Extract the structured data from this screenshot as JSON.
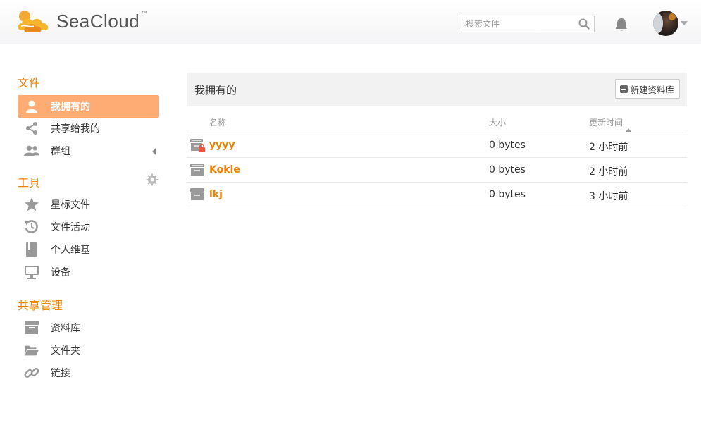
{
  "header": {
    "logo_text": "SeaCloud",
    "logo_tm": "™",
    "search_placeholder": "搜索文件"
  },
  "sidebar": {
    "files_title": "文件",
    "files_items": [
      {
        "label": "我拥有的",
        "icon": "user-icon",
        "active": true
      },
      {
        "label": "共享给我的",
        "icon": "share-icon"
      },
      {
        "label": "群组",
        "icon": "group-icon"
      }
    ],
    "tools_title": "工具",
    "tools_items": [
      {
        "label": "星标文件",
        "icon": "star-icon"
      },
      {
        "label": "文件活动",
        "icon": "history-icon"
      },
      {
        "label": "个人维基",
        "icon": "book-icon"
      },
      {
        "label": "设备",
        "icon": "monitor-icon"
      }
    ],
    "share_title": "共享管理",
    "share_items": [
      {
        "label": "资料库",
        "icon": "archive-icon"
      },
      {
        "label": "文件夹",
        "icon": "folder-open-icon"
      },
      {
        "label": "链接",
        "icon": "link-icon"
      }
    ]
  },
  "main": {
    "title": "我拥有的",
    "new_library_label": "新建资料库",
    "columns": {
      "name": "名称",
      "size": "大小",
      "updated": "更新时间"
    },
    "rows": [
      {
        "name": "yyyy",
        "size": "0 bytes",
        "updated": "2 小时前",
        "encrypted": true
      },
      {
        "name": "Kokle",
        "size": "0 bytes",
        "updated": "2 小时前",
        "encrypted": false
      },
      {
        "name": "lkj",
        "size": "0 bytes",
        "updated": "3 小时前",
        "encrypted": false
      }
    ]
  },
  "colors": {
    "accent": "#eb8205",
    "active_bg": "#feac74"
  }
}
